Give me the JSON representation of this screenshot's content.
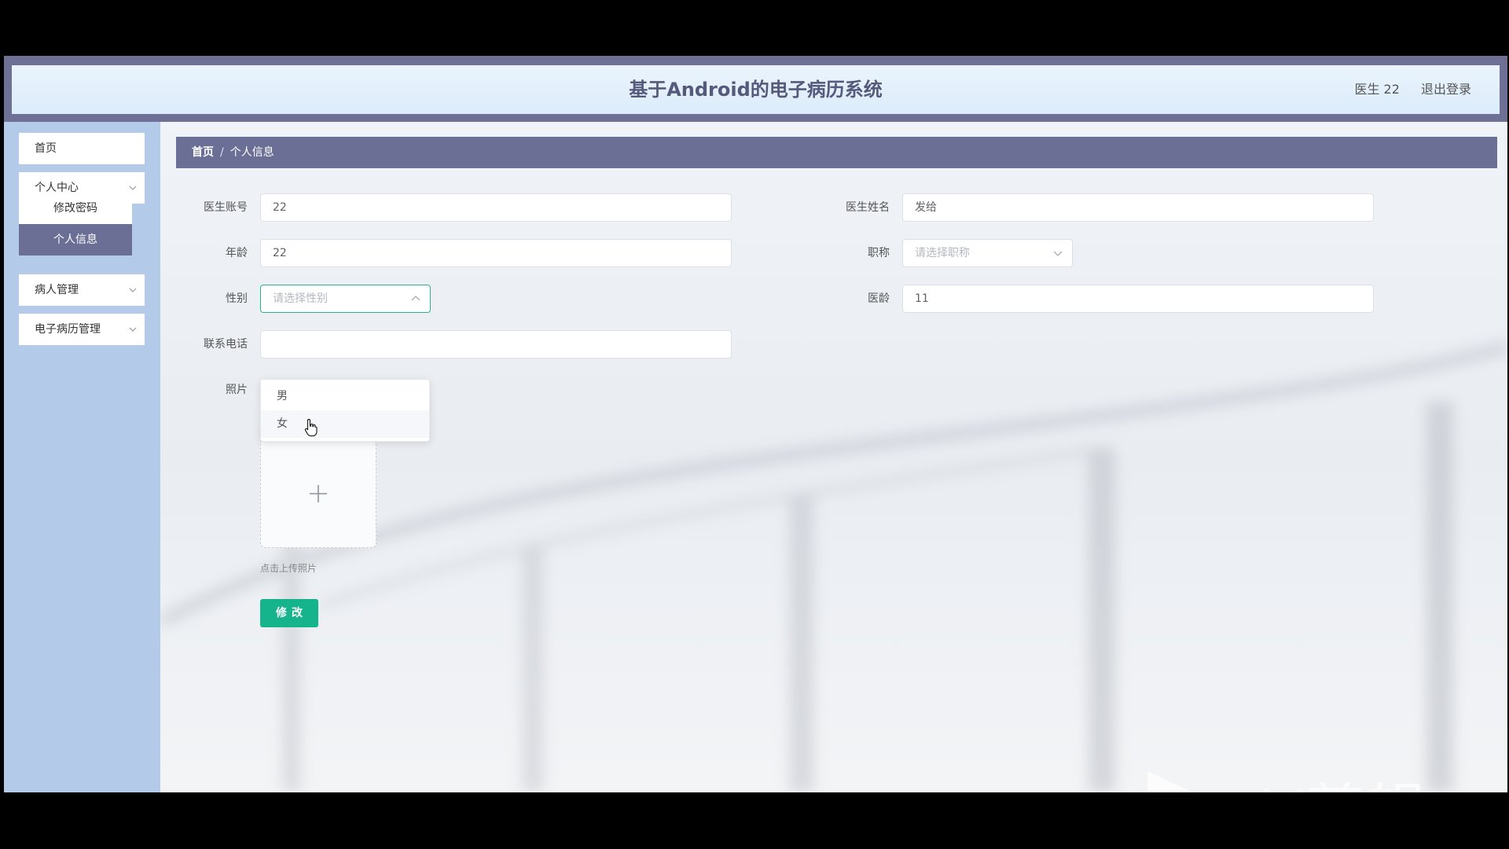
{
  "header": {
    "title": "基于Android的电子病历系统",
    "user": "医生 22",
    "logout": "退出登录"
  },
  "sidebar": {
    "items": [
      {
        "label": "首页"
      },
      {
        "label": "个人中心"
      },
      {
        "label": "病人管理"
      },
      {
        "label": "电子病历管理"
      }
    ],
    "submenu": [
      {
        "label": "修改密码"
      },
      {
        "label": "个人信息"
      }
    ]
  },
  "breadcrumb": {
    "home": "首页",
    "separator": "/",
    "current": "个人信息"
  },
  "form": {
    "account_label": "医生账号",
    "account_value": "22",
    "name_label": "医生姓名",
    "name_value": "发给",
    "age_label": "年龄",
    "age_value": "22",
    "title_label": "职称",
    "title_placeholder": "请选择职称",
    "gender_label": "性别",
    "gender_placeholder": "请选择性别",
    "gender_options": [
      "男",
      "女"
    ],
    "seniority_label": "医龄",
    "seniority_value": "11",
    "phone_label": "联系电话",
    "phone_value": "",
    "photo_label": "照片",
    "upload_tip": "点击上传照片",
    "submit_label": "修改"
  },
  "watermark": {
    "text": "eV剪辑"
  },
  "colors": {
    "header_band": "#6e7096",
    "sidebar_bg": "#b3cbe9",
    "breadcrumb_bg": "#6b6f96",
    "accent": "#16b48c",
    "focus_border": "#25b396"
  }
}
